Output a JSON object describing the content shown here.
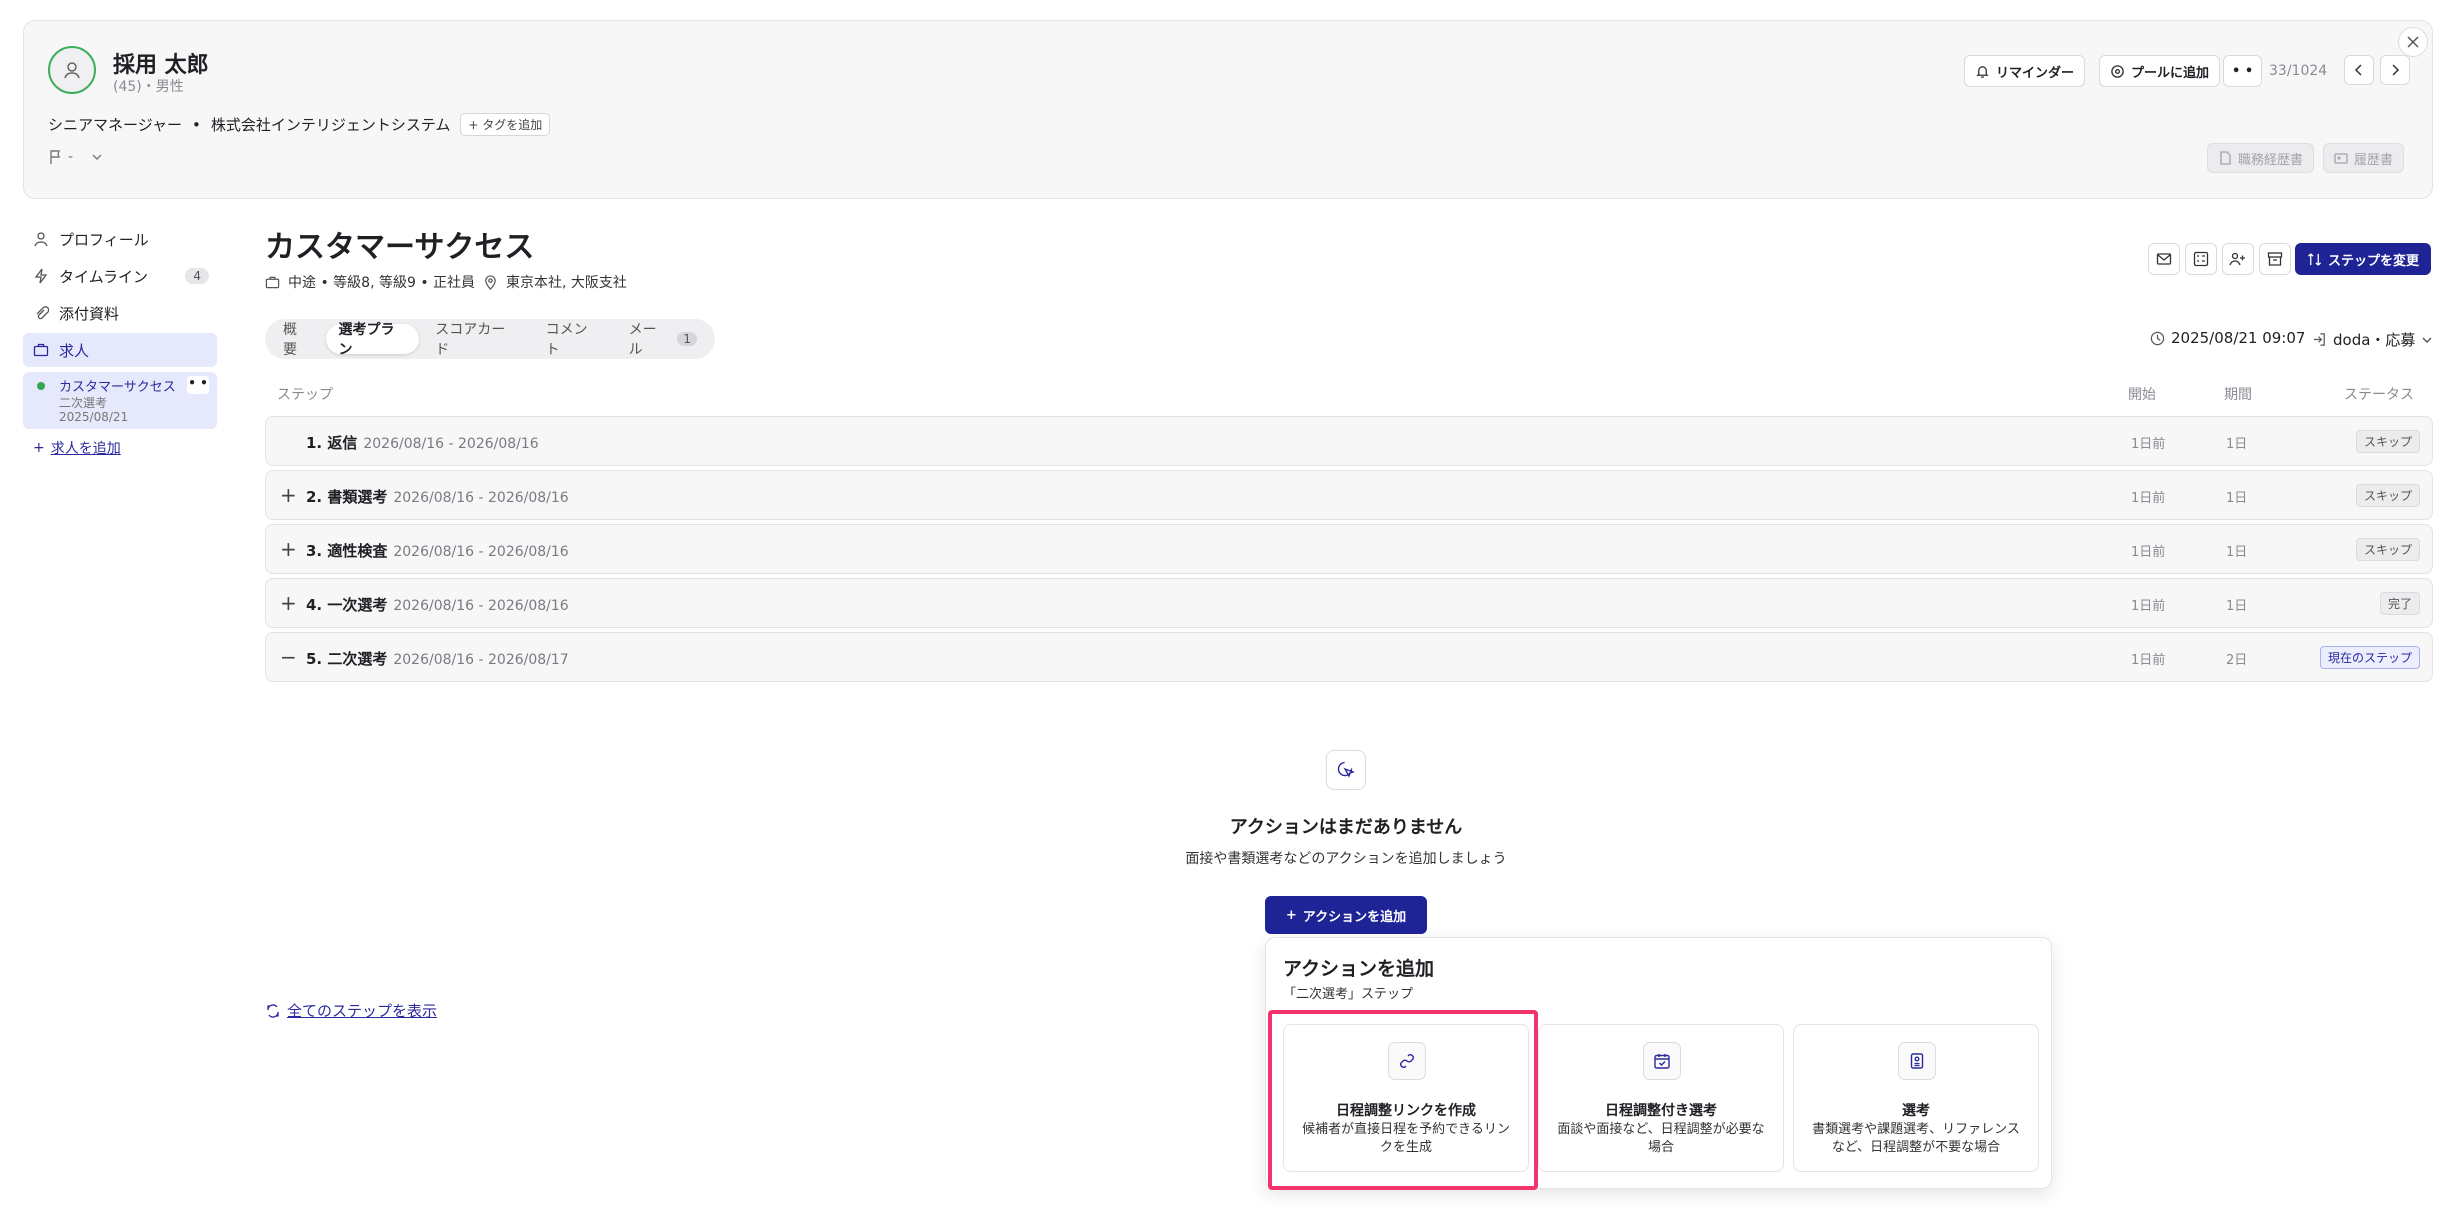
{
  "header": {
    "name": "採用 太郎",
    "meta": "(45)・男性",
    "role": "シニアマネージャー",
    "company": "株式会社インテリジェントシステム",
    "add_tag": "タグを追加",
    "flag_value": "-",
    "reminder": "リマインダー",
    "add_to_pool": "プールに追加",
    "more": "• •",
    "counter": "33/1024",
    "resume_work": "職務経歴書",
    "resume": "履歴書"
  },
  "sidebar": {
    "items": [
      {
        "label": "プロフィール"
      },
      {
        "label": "タイムライン",
        "badge": "4"
      },
      {
        "label": "添付資料"
      },
      {
        "label": "求人"
      }
    ],
    "job": {
      "title": "カスタマーサクセス",
      "stage": "二次選考",
      "date": "2025/08/21",
      "more": "• •"
    },
    "add_job": "求人を追加"
  },
  "main": {
    "title": "カスタマーサクセス",
    "sub_type": "中途 • 等級8, 等級9 • 正社員",
    "sub_location": "東京本社, 大阪支社",
    "change_step": "ステップを変更",
    "tabs": [
      {
        "label": "概要"
      },
      {
        "label": "選考プラン"
      },
      {
        "label": "スコアカード"
      },
      {
        "label": "コメント"
      },
      {
        "label": "メール",
        "count": "1"
      }
    ],
    "datetime": "2025/08/21 09:07",
    "source": "doda・応募",
    "columns": {
      "step": "ステップ",
      "start": "開始",
      "period": "期間",
      "status": "ステータス"
    },
    "steps": [
      {
        "toggle": "",
        "name": "1. 返信",
        "range": "2026/08/16 - 2026/08/16",
        "start": "1日前",
        "period": "1日",
        "status": "スキップ"
      },
      {
        "toggle": "+",
        "name": "2. 書類選考",
        "range": "2026/08/16 - 2026/08/16",
        "start": "1日前",
        "period": "1日",
        "status": "スキップ"
      },
      {
        "toggle": "+",
        "name": "3. 適性検査",
        "range": "2026/08/16 - 2026/08/16",
        "start": "1日前",
        "period": "1日",
        "status": "スキップ"
      },
      {
        "toggle": "+",
        "name": "4. 一次選考",
        "range": "2026/08/16 - 2026/08/16",
        "start": "1日前",
        "period": "1日",
        "status": "完了"
      },
      {
        "toggle": "−",
        "name": "5. 二次選考",
        "range": "2026/08/16 - 2026/08/17",
        "start": "1日前",
        "period": "2日",
        "status": "現在のステップ"
      }
    ],
    "empty_title": "アクションはまだありません",
    "empty_sub": "面接や書類選考などのアクションを追加しましょう",
    "add_action": "アクションを追加",
    "show_all_steps": "全てのステップを表示"
  },
  "popup": {
    "title": "アクションを追加",
    "subtitle": "「二次選考」ステップ",
    "cards": [
      {
        "title": "日程調整リンクを作成",
        "desc": "候補者が直接日程を予約できるリンクを生成",
        "icon": "link-icon"
      },
      {
        "title": "日程調整付き選考",
        "desc": "面談や面接など、日程調整が必要な場合",
        "icon": "calendar-check-icon"
      },
      {
        "title": "選考",
        "desc": "書類選考や課題選考、リファレンスなど、日程調整が不要な場合",
        "icon": "clipboard-icon"
      }
    ]
  },
  "colors": {
    "primary": "#1e2396",
    "highlight": "#f2336c",
    "online": "#2fa84f"
  }
}
